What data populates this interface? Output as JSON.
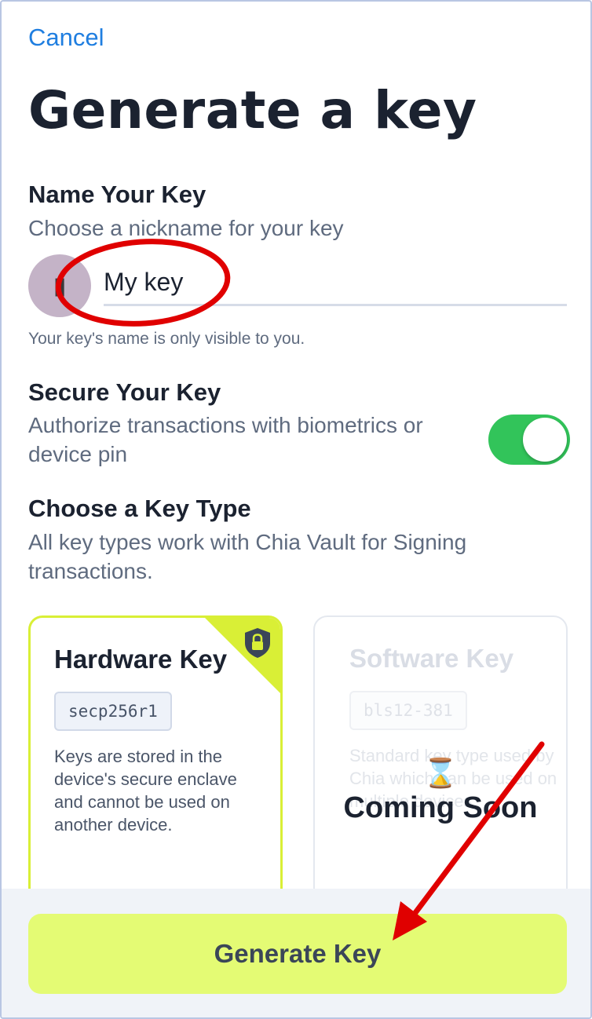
{
  "nav": {
    "cancel_label": "Cancel"
  },
  "title": "Generate a key",
  "name_section": {
    "heading": "Name Your Key",
    "subtitle": "Choose a nickname for your key",
    "input_value": "My key",
    "hint": "Your key's name is only visible to you."
  },
  "secure_section": {
    "heading": "Secure Your Key",
    "subtitle": "Authorize transactions with biometrics or device pin",
    "toggle_on": true
  },
  "type_section": {
    "heading": "Choose a Key Type",
    "subtitle": "All key types work with Chia Vault for Signing transactions."
  },
  "cards": {
    "hardware": {
      "title": "Hardware Key",
      "tag": "secp256r1",
      "description": "Keys are stored in the device's secure enclave and cannot be used on another device.",
      "badge_icon": "lock-icon"
    },
    "software": {
      "title": "Software Key",
      "tag": "bls12-381",
      "description": "Standard key type used by Chia which can be used on multiple devices.",
      "status_icon": "hourglass-icon",
      "status_label": "Coming Soon"
    }
  },
  "footer": {
    "generate_label": "Generate Key"
  },
  "colors": {
    "accent_link": "#1f7ee0",
    "toggle_on": "#32c45a",
    "primary_button": "#e4fb74",
    "selected_card_border": "#d9ef36",
    "annotation_red": "#e00000"
  }
}
